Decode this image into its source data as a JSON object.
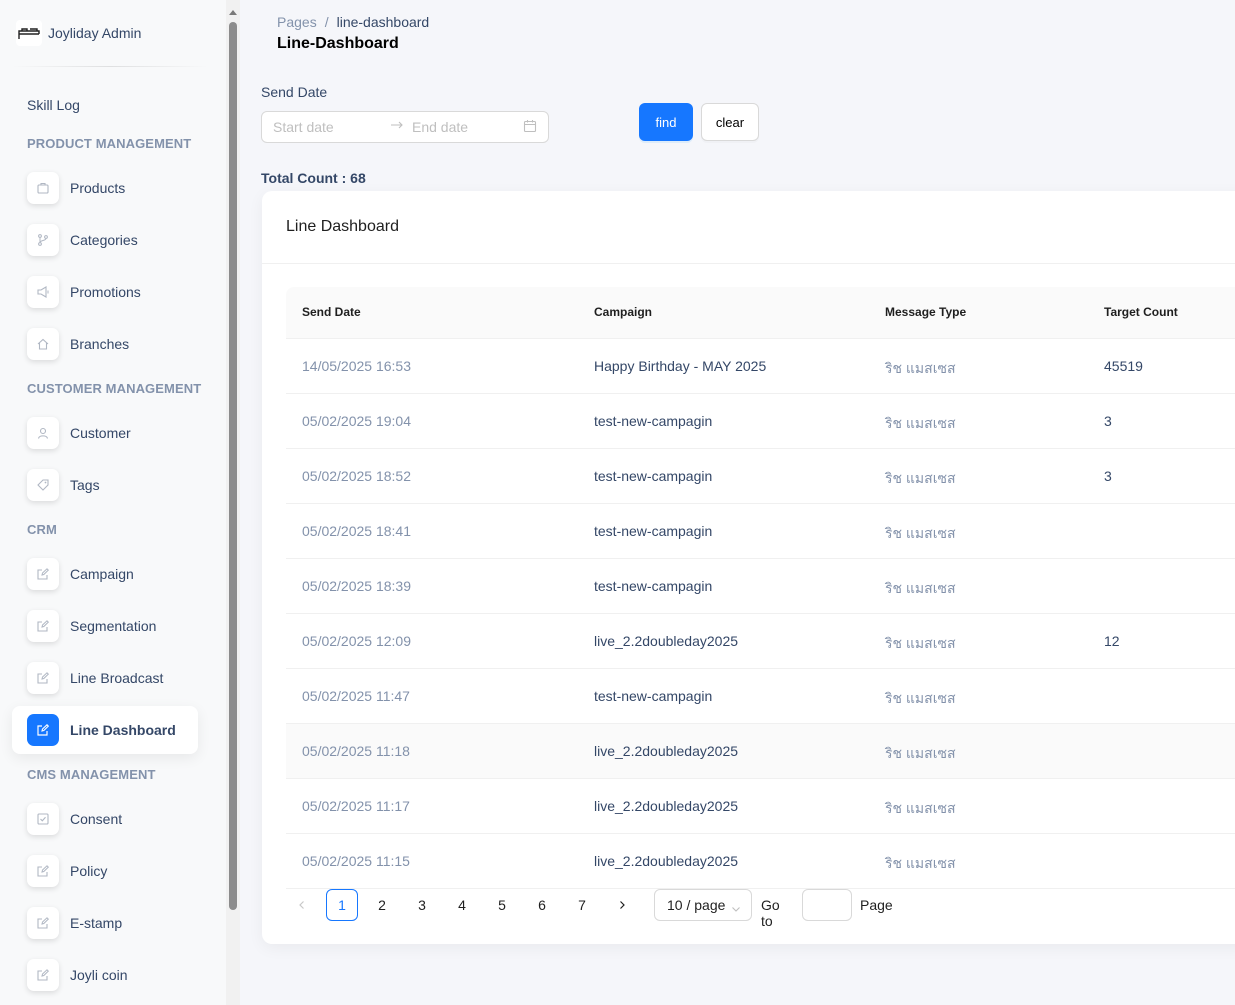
{
  "sidebar": {
    "brand": "Joyliday Admin",
    "skill_log": "Skill Log",
    "sections": {
      "product": "PRODUCT MANAGEMENT",
      "customer": "CUSTOMER MANAGEMENT",
      "crm": "CRM",
      "cms": "CMS MANAGEMENT"
    },
    "items": {
      "products": {
        "label": "Products",
        "icon": "bag-icon"
      },
      "categories": {
        "label": "Categories",
        "icon": "branch-icon"
      },
      "promotions": {
        "label": "Promotions",
        "icon": "megaphone-icon"
      },
      "branches": {
        "label": "Branches",
        "icon": "home-icon"
      },
      "customer": {
        "label": "Customer",
        "icon": "user-icon"
      },
      "tags": {
        "label": "Tags",
        "icon": "tag-icon"
      },
      "campaign": {
        "label": "Campaign",
        "icon": "edit-icon"
      },
      "segmentation": {
        "label": "Segmentation",
        "icon": "edit-icon"
      },
      "line_broadcast": {
        "label": "Line Broadcast",
        "icon": "edit-icon"
      },
      "line_dashboard": {
        "label": "Line Dashboard",
        "icon": "edit-icon",
        "active": true
      },
      "consent": {
        "label": "Consent",
        "icon": "check-square-icon"
      },
      "policy": {
        "label": "Policy",
        "icon": "edit-icon"
      },
      "estamp": {
        "label": "E-stamp",
        "icon": "edit-icon"
      },
      "joyli_coin": {
        "label": "Joyli coin",
        "icon": "edit-icon"
      }
    }
  },
  "header": {
    "breadcrumb_root": "Pages",
    "breadcrumb_sep": "/",
    "breadcrumb_current": "line-dashboard",
    "title": "Line-Dashboard"
  },
  "filter": {
    "label": "Send Date",
    "start_placeholder": "Start date",
    "end_placeholder": "End date",
    "find": "find",
    "clear": "clear"
  },
  "total_count": "Total Count : 68",
  "card": {
    "title": "Line Dashboard",
    "columns": [
      "Send Date",
      "Campaign",
      "Message Type",
      "Target Count"
    ],
    "rows": [
      [
        "14/05/2025 16:53",
        "Happy Birthday - MAY 2025",
        "ริช แมสเซส",
        "45519"
      ],
      [
        "05/02/2025 19:04",
        "test-new-campagin",
        "ริช แมสเซส",
        "3"
      ],
      [
        "05/02/2025 18:52",
        "test-new-campagin",
        "ริช แมสเซส",
        "3"
      ],
      [
        "05/02/2025 18:41",
        "test-new-campagin",
        "ริช แมสเซส",
        ""
      ],
      [
        "05/02/2025 18:39",
        "test-new-campagin",
        "ริช แมสเซส",
        ""
      ],
      [
        "05/02/2025 12:09",
        "live_2.2doubleday2025",
        "ริช แมสเซส",
        "12"
      ],
      [
        "05/02/2025 11:47",
        "test-new-campagin",
        "ริช แมสเซส",
        ""
      ],
      [
        "05/02/2025 11:18",
        "live_2.2doubleday2025",
        "ริช แมสเซส",
        ""
      ],
      [
        "05/02/2025 11:17",
        "live_2.2doubleday2025",
        "ริช แมสเซส",
        ""
      ],
      [
        "05/02/2025 11:15",
        "live_2.2doubleday2025",
        "ริช แมสเซส",
        ""
      ]
    ]
  },
  "pagination": {
    "pages": [
      "1",
      "2",
      "3",
      "4",
      "5",
      "6",
      "7"
    ],
    "current": "1",
    "page_size": "10 / page",
    "goto": "Go to",
    "page": "Page"
  },
  "colors": {
    "accent": "#1677ff",
    "text": "#344767",
    "muted": "#8392ab"
  }
}
